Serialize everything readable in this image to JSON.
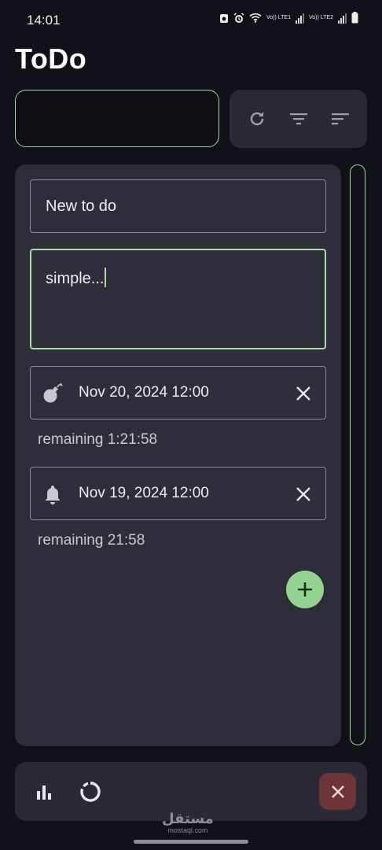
{
  "status_bar": {
    "time": "14:01",
    "sim1_label": "Vo)) LTE1",
    "sim2_label": "Vo)) LTE2",
    "icons": [
      "camera-notification-icon",
      "alarm-icon",
      "wifi-icon",
      "signal-icon",
      "battery-icon"
    ]
  },
  "app": {
    "title": "ToDo"
  },
  "search": {
    "value": ""
  },
  "toolbar": {
    "icons": [
      "refresh-icon",
      "filter-icon",
      "sort-icon"
    ]
  },
  "form": {
    "title_value": "New to do",
    "description_value": "simple...",
    "deadline": {
      "icon": "bomb-icon",
      "value": "Nov 20, 2024 12:00",
      "remaining": "remaining 1:21:58"
    },
    "reminder": {
      "icon": "bell-icon",
      "value": "Nov 19, 2024 12:00",
      "remaining": "remaining 21:58"
    }
  },
  "bottom_bar": {
    "icons": [
      "bar-chart-icon",
      "progress-ring-icon",
      "close-icon"
    ]
  },
  "watermark": {
    "arabic": "مستقل",
    "latin": "mostaql.com"
  },
  "colors": {
    "background": "#111119",
    "panel": "#2e2e3a",
    "accent_green": "#9fd99b",
    "add_button": "#93d490",
    "cancel_button": "#6e3438"
  }
}
